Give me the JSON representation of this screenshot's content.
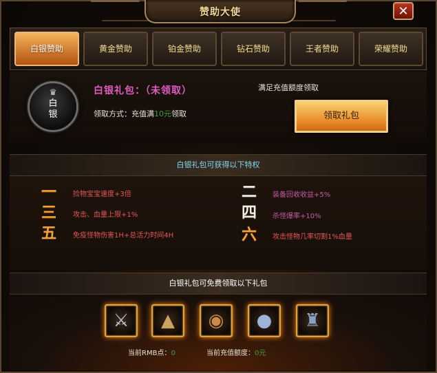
{
  "window": {
    "title": "赞助大使",
    "close_label": "✕"
  },
  "tabs": [
    {
      "label": "白银赞助",
      "active": true
    },
    {
      "label": "黄金赞助",
      "active": false
    },
    {
      "label": "铂金赞助",
      "active": false
    },
    {
      "label": "钻石赞助",
      "active": false
    },
    {
      "label": "王者赞助",
      "active": false
    },
    {
      "label": "荣耀赞助",
      "active": false
    }
  ],
  "badge": {
    "icon": "crown-icon",
    "text": "白银"
  },
  "pack": {
    "title": "白银礼包：（未领取）",
    "method_prefix": "领取方式：充值满",
    "method_amount": "10元",
    "method_suffix": "领取",
    "hint": "满足充值额度领取",
    "claim_label": "领取礼包"
  },
  "perks_header": "白银礼包可获得以下特权",
  "perks": [
    {
      "num": "一",
      "text": "捡物宝宝速度+3倍"
    },
    {
      "num": "二",
      "text": "装备回收收益+5%"
    },
    {
      "num": "三",
      "text": "攻击、血量上限+1%"
    },
    {
      "num": "四",
      "text": "杀怪爆率+10%"
    },
    {
      "num": "五",
      "text": "免疫怪物伤害1H+总活力时间4H"
    },
    {
      "num": "六",
      "text": "攻击怪物几率切割1%血量"
    }
  ],
  "gifts_header": "白银礼包可免费领取以下礼包",
  "gifts": [
    {
      "icon": "claw-weapon-icon"
    },
    {
      "icon": "straw-hat-icon"
    },
    {
      "icon": "round-shield-icon"
    },
    {
      "icon": "orb-icon"
    },
    {
      "icon": "armor-icon"
    }
  ],
  "footer": {
    "rmb_label": "当前RMB点：",
    "rmb_value": "0",
    "recharge_label": "当前充值额度：",
    "recharge_value": "0元"
  },
  "colors": {
    "accent": "#f5b35a",
    "perk_red": "#e4565c",
    "perk_pink": "#c45aa5",
    "title_pink": "#e05bc3",
    "value_green": "#3aa03a"
  }
}
